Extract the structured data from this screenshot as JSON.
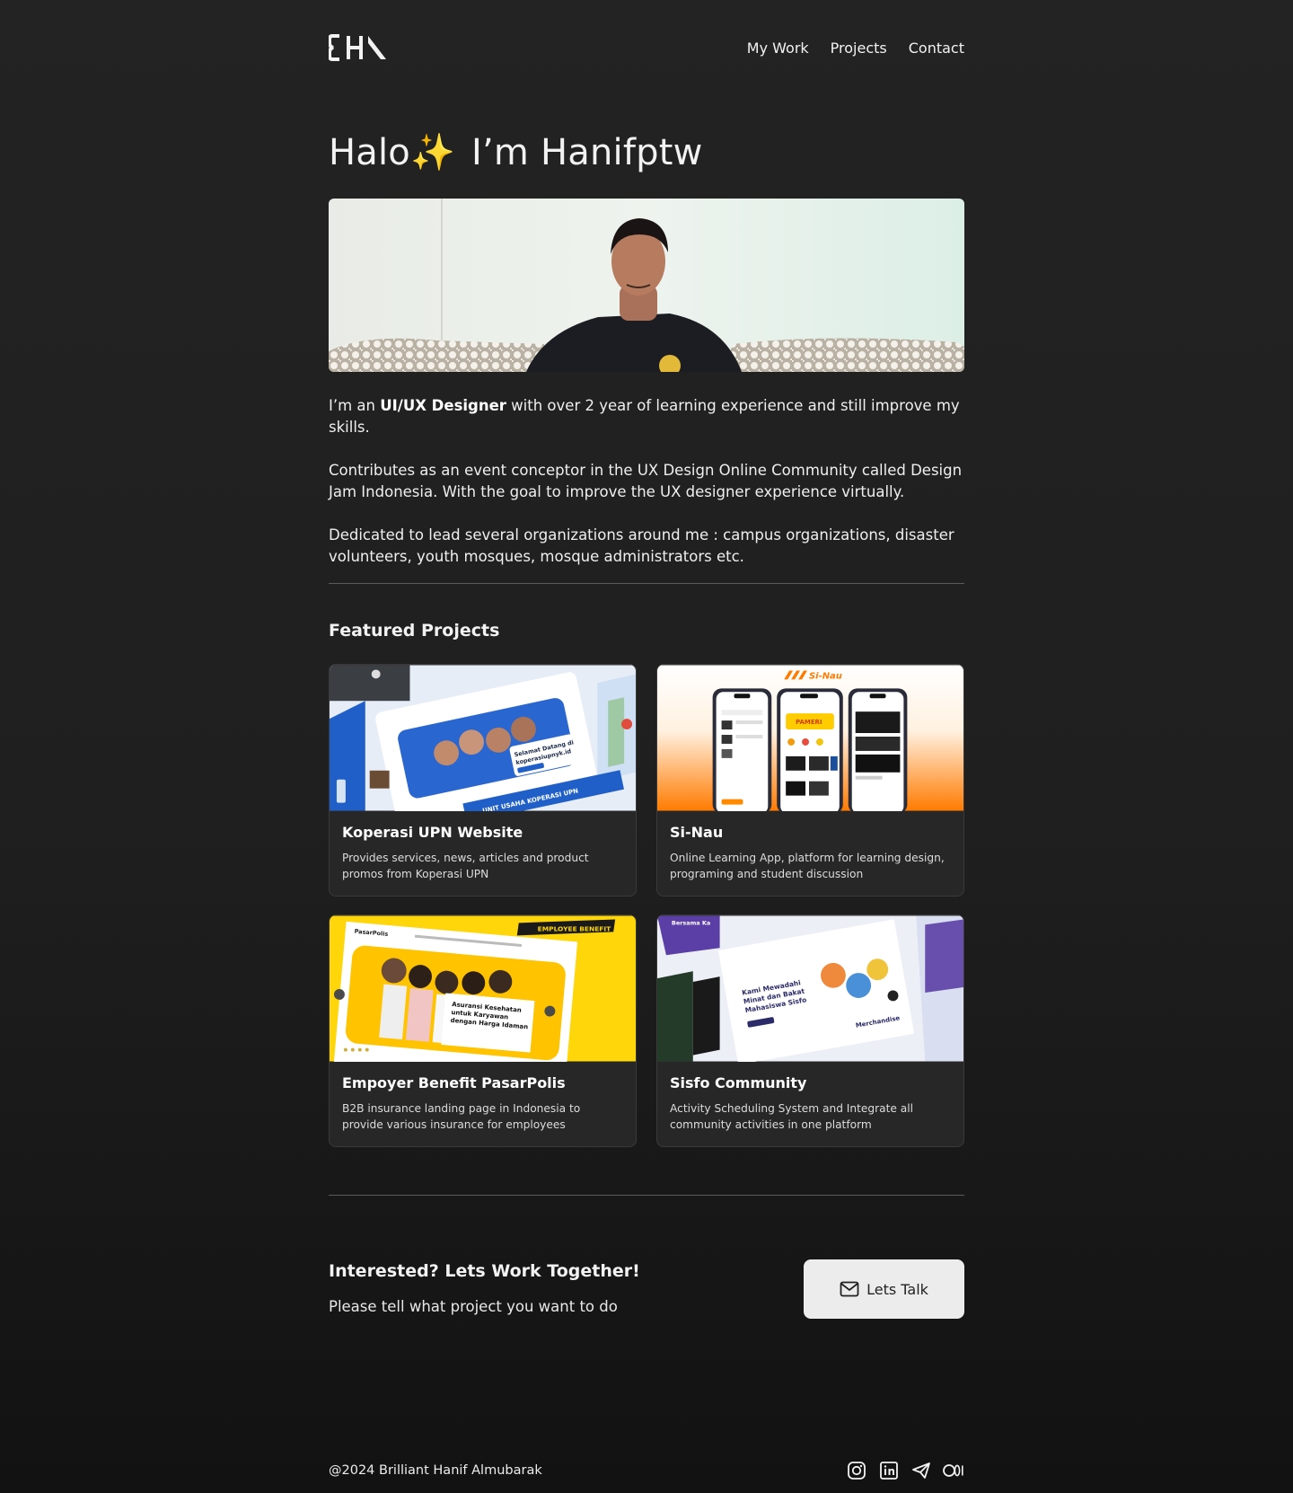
{
  "header": {
    "logo_text": "EHA",
    "nav": [
      {
        "label": "My Work"
      },
      {
        "label": "Projects"
      },
      {
        "label": "Contact"
      }
    ]
  },
  "hero": {
    "greeting": "Halo✨",
    "name_line": "I’m Hanifptw",
    "bio": {
      "p1_prefix": "I’m an ",
      "p1_strong": "UI/UX Designer",
      "p1_suffix": " with over 2 year of learning experience and still improve my skills.",
      "p2": "Contributes as an event conceptor in the UX Design Online Community called Design Jam Indonesia. With the goal to improve the UX designer experience virtually.",
      "p3": "Dedicated to lead several organizations around me : campus organizations, disaster volunteers, youth mosques, mosque administrators etc."
    }
  },
  "projects": {
    "title": "Featured Projects",
    "items": [
      {
        "title": "Koperasi UPN Website",
        "desc": "Provides services, news, articles and product promos from Koperasi UPN",
        "thumb_caption_1": "Selamat Datang di",
        "thumb_caption_2": "koperasiupnyk.id",
        "thumb_banner": "UNIT USAHA KOPERASI UPN"
      },
      {
        "title": "Si-Nau",
        "desc": "Online Learning App, platform for learning design, programing and student discussion",
        "thumb_logo": "Si-Nau",
        "thumb_badge": "PAMERI"
      },
      {
        "title": "Empoyer Benefit PasarPolis",
        "desc": "B2B insurance landing page in Indonesia to provide various insurance for employees",
        "thumb_tag": "EMPLOYEE BENEFIT",
        "thumb_brand": "PasarPolis",
        "thumb_headline_1": "Asuransi Kesehatan",
        "thumb_headline_2": "untuk Karyawan",
        "thumb_headline_3": "dengan Harga Idaman"
      },
      {
        "title": "Sisfo Community",
        "desc": "Activity Scheduling System and Integrate all community activities in one platform",
        "thumb_headline_1": "Kami Mewadahi",
        "thumb_headline_2": "Minat dan Bakat",
        "thumb_headline_3": "Mahasiswa Sisfo",
        "thumb_sub": "Merchandise",
        "thumb_top": "Bersama Ka"
      }
    ]
  },
  "cta": {
    "title": "Interested? Lets Work Together!",
    "subtitle": "Please tell what project you want to do",
    "button_label": "Lets Talk"
  },
  "footer": {
    "copyright": "@2024 Brilliant Hanif Almubarak",
    "socials": [
      "instagram-icon",
      "linkedin-icon",
      "telegram-icon",
      "medium-icon"
    ]
  },
  "colors": {
    "background": "#232323",
    "card": "#272727",
    "button": "#ececec",
    "sinau_orange": "#ff8a00",
    "pasarpolis_yellow": "#ffd400",
    "koperasi_blue": "#1f5fc7",
    "sisfo_purple": "#5b3fa6"
  }
}
